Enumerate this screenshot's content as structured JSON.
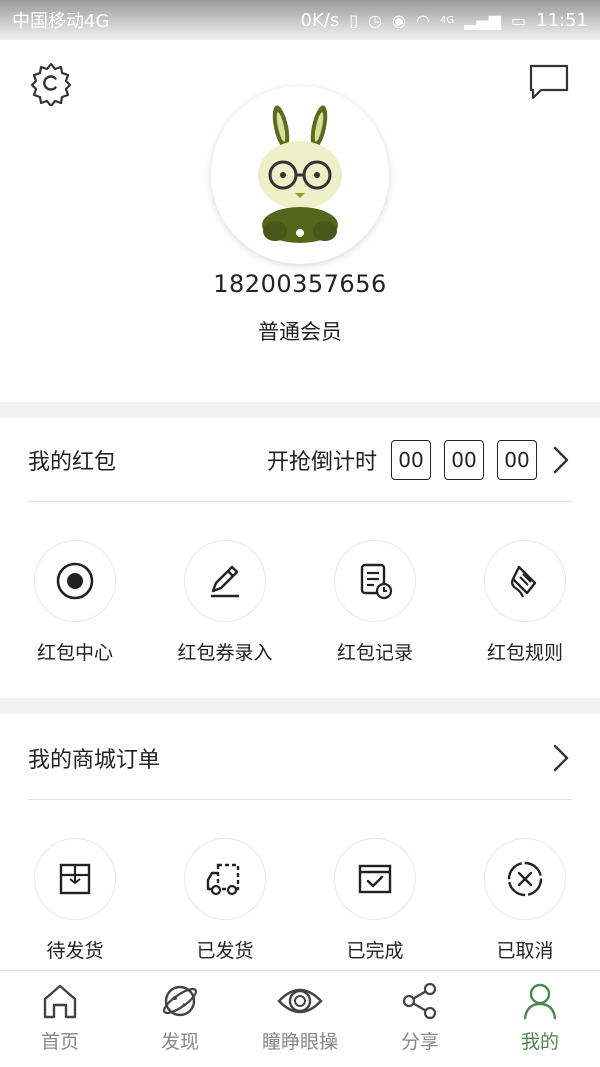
{
  "status_bar": {
    "carrier": "中国移动4G",
    "speed": "0K/s",
    "network": "4G",
    "time": "11:51"
  },
  "header": {
    "phone": "18200357656",
    "member_level": "普通会员"
  },
  "red_packet": {
    "title": "我的红包",
    "countdown_label": "开抢倒计时",
    "countdown": [
      "00",
      "00",
      "00"
    ],
    "items": [
      {
        "label": "红包中心",
        "icon": "target-icon"
      },
      {
        "label": "红包券录入",
        "icon": "pencil-icon"
      },
      {
        "label": "红包记录",
        "icon": "record-clock-icon"
      },
      {
        "label": "红包规则",
        "icon": "scroll-icon"
      }
    ]
  },
  "orders": {
    "title": "我的商城订单",
    "items": [
      {
        "label": "待发货",
        "icon": "box-icon"
      },
      {
        "label": "已发货",
        "icon": "truck-icon"
      },
      {
        "label": "已完成",
        "icon": "calendar-check-icon"
      },
      {
        "label": "已取消",
        "icon": "cancel-circle-icon"
      }
    ]
  },
  "tab_bar": {
    "tabs": [
      {
        "label": "首页",
        "icon": "home-icon"
      },
      {
        "label": "发现",
        "icon": "planet-icon"
      },
      {
        "label": "瞳睁眼操",
        "icon": "eye-icon"
      },
      {
        "label": "分享",
        "icon": "share-icon"
      },
      {
        "label": "我的",
        "icon": "user-icon",
        "active": true
      }
    ],
    "active_color": "#4a8a4e"
  }
}
